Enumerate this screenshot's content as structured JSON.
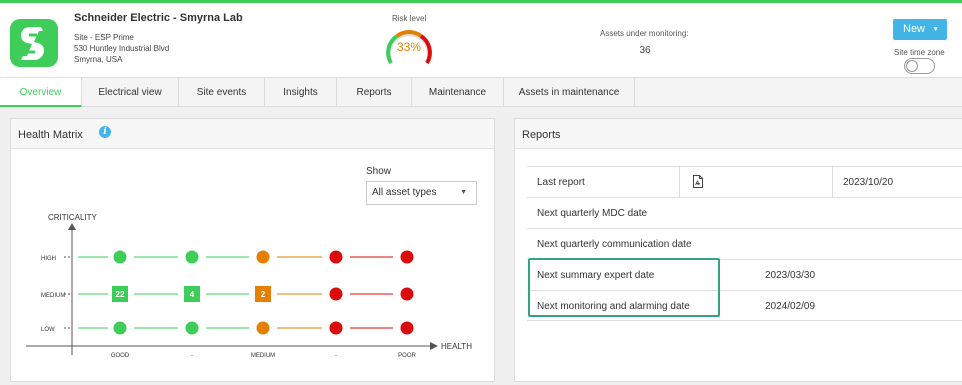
{
  "header": {
    "site_name": "Schneider Electric - Smyrna Lab",
    "site_type": "Site - ESP Prime",
    "address_line1": "530 Huntley Industrial Blvd",
    "address_line2": "Smyrna, USA",
    "risk_level_label": "Risk level",
    "risk_level_value": "33%",
    "risk_level_fraction": 0.33,
    "assets_label": "Assets under monitoring:",
    "assets_value": "36",
    "new_button_label": "New",
    "site_time_zone_label": "Site time zone",
    "site_time_zone_on": false,
    "colors": {
      "brand_green": "#3dcd58",
      "accent_blue": "#42b4e6",
      "risk_orange": "#e47f00"
    }
  },
  "tabs": [
    {
      "label": "Overview",
      "active": true
    },
    {
      "label": "Electrical view",
      "active": false
    },
    {
      "label": "Site events",
      "active": false
    },
    {
      "label": "Insights",
      "active": false
    },
    {
      "label": "Reports",
      "active": false
    },
    {
      "label": "Maintenance",
      "active": false
    },
    {
      "label": "Assets in maintenance",
      "active": false
    }
  ],
  "health_matrix": {
    "title": "Health Matrix",
    "show_label": "Show",
    "filter_value": "All asset types",
    "y_axis_label": "CRITICALITY",
    "x_axis_label": "HEALTH",
    "criticality_levels": [
      "HIGH",
      "MEDIUM",
      "LOW"
    ],
    "health_levels": [
      "GOOD",
      "-",
      "MEDIUM",
      "-",
      "POOR"
    ],
    "colors": [
      "#3dcd58",
      "#3dcd58",
      "#e47f00",
      "#dc0a0a",
      "#dc0a0a"
    ],
    "cells": [
      [
        null,
        null,
        null,
        null,
        null
      ],
      [
        "22",
        "4",
        "2",
        null,
        null
      ],
      [
        null,
        null,
        null,
        null,
        null
      ]
    ]
  },
  "reports": {
    "title": "Reports",
    "rows": [
      {
        "label": "Last report",
        "icon": "pdf-icon",
        "date": "2023/10/20"
      },
      {
        "label": "Next quarterly MDC date",
        "date": ""
      },
      {
        "label": "Next quarterly communication date",
        "date": ""
      },
      {
        "label": "Next summary expert date",
        "date": "2023/03/30"
      },
      {
        "label": "Next monitoring and alarming date",
        "date": "2024/02/09"
      }
    ]
  }
}
